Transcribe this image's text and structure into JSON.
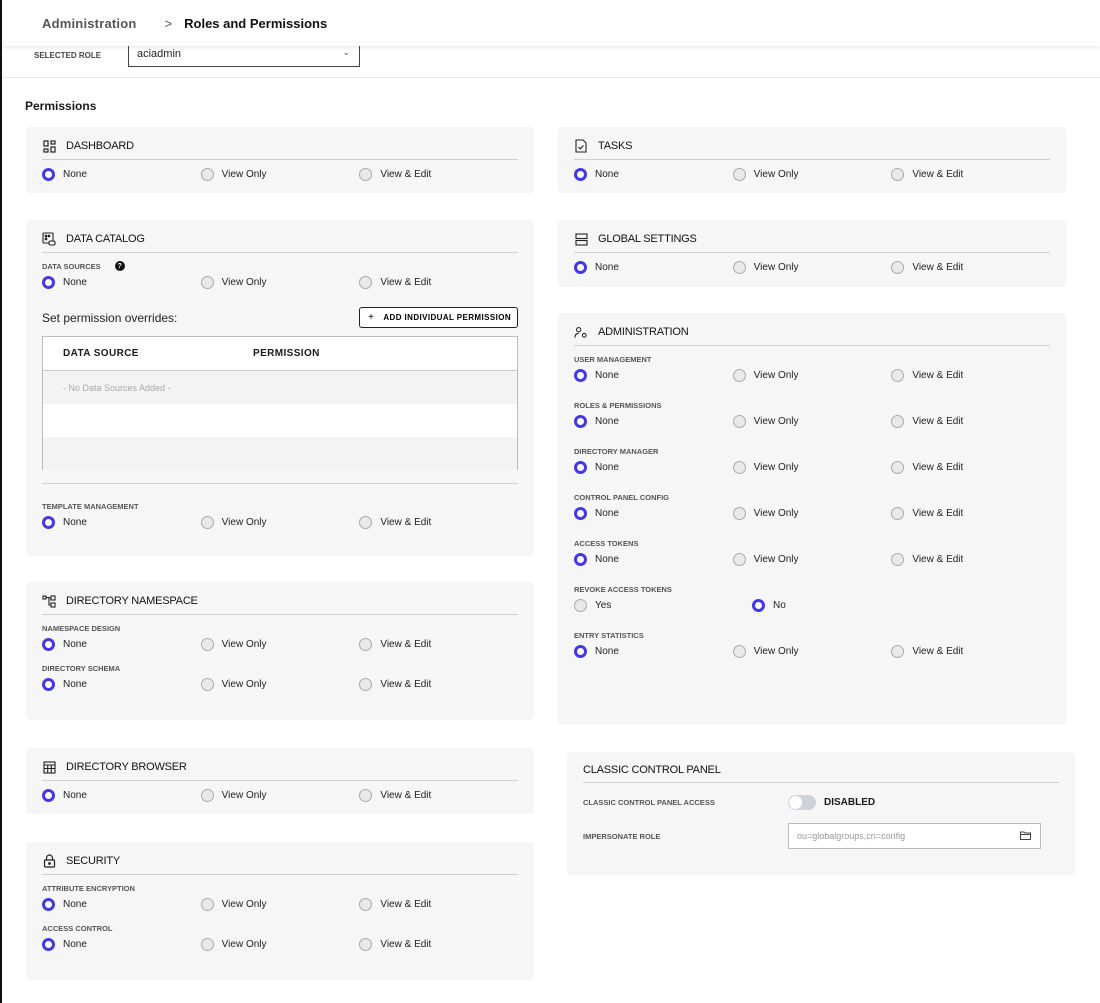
{
  "breadcrumb": {
    "parent": "Administration",
    "separator": ">",
    "current": "Roles and Permissions"
  },
  "role": {
    "label": "SELECTED ROLE",
    "value": "aciadmin"
  },
  "permissions_title": "Permissions",
  "options3": [
    "None",
    "View Only",
    "View & Edit"
  ],
  "sections": {
    "dashboard": {
      "title": "DASHBOARD",
      "icon": "dashboard-grid-icon",
      "rows": [
        {
          "label": "",
          "selected": "None"
        }
      ]
    },
    "data_catalog": {
      "title": "DATA CATALOG",
      "icon": "data-catalog-icon",
      "data_sources": {
        "label": "DATA SOURCES",
        "selected": "None"
      },
      "overrides": {
        "label": "Set permission overrides:",
        "add_button": "ADD INDIVIDUAL PERMISSION",
        "columns": [
          "DATA SOURCE",
          "PERMISSION"
        ],
        "empty_text": "- No Data Sources Added -"
      },
      "template_management": {
        "label": "TEMPLATE MANAGEMENT",
        "selected": "None"
      }
    },
    "directory_namespace": {
      "title": "DIRECTORY NAMESPACE",
      "icon": "namespace-tree-icon",
      "rows": [
        {
          "label": "NAMESPACE DESIGN",
          "selected": "None"
        },
        {
          "label": "DIRECTORY SCHEMA",
          "selected": "None"
        }
      ]
    },
    "directory_browser": {
      "title": "DIRECTORY BROWSER",
      "icon": "table-icon",
      "rows": [
        {
          "label": "",
          "selected": "None"
        }
      ]
    },
    "security": {
      "title": "SECURITY",
      "icon": "lock-icon",
      "rows": [
        {
          "label": "ATTRIBUTE ENCRYPTION",
          "selected": "None"
        },
        {
          "label": "ACCESS CONTROL",
          "selected": "None"
        }
      ]
    },
    "tasks": {
      "title": "TASKS",
      "icon": "tasks-document-icon",
      "rows": [
        {
          "label": "",
          "selected": "None"
        }
      ]
    },
    "global_settings": {
      "title": "GLOBAL SETTINGS",
      "icon": "server-icon",
      "rows": [
        {
          "label": "",
          "selected": "None"
        }
      ]
    },
    "administration": {
      "title": "ADMINISTRATION",
      "icon": "user-gear-icon",
      "rows": [
        {
          "label": "USER MANAGEMENT",
          "selected": "None"
        },
        {
          "label": "ROLES & PERMISSIONS",
          "selected": "None"
        },
        {
          "label": "DIRECTORY MANAGER",
          "selected": "None"
        },
        {
          "label": "CONTROL PANEL CONFIG",
          "selected": "None"
        },
        {
          "label": "ACCESS TOKENS",
          "selected": "None"
        }
      ],
      "revoke": {
        "label": "REVOKE ACCESS TOKENS",
        "options": [
          "Yes",
          "No"
        ],
        "selected": "No"
      },
      "entry_statistics": {
        "label": "ENTRY STATISTICS",
        "selected": "None"
      }
    },
    "classic": {
      "title": "CLASSIC CONTROL PANEL",
      "access_label": "CLASSIC CONTROL PANEL ACCESS",
      "access_state": "DISABLED",
      "access_enabled": false,
      "impersonate_label": "IMPERSONATE ROLE",
      "impersonate_placeholder": "ou=globalgroups,cn=config"
    }
  },
  "colors": {
    "accent": "#4438e6",
    "card_bg": "#f6f6f6"
  }
}
